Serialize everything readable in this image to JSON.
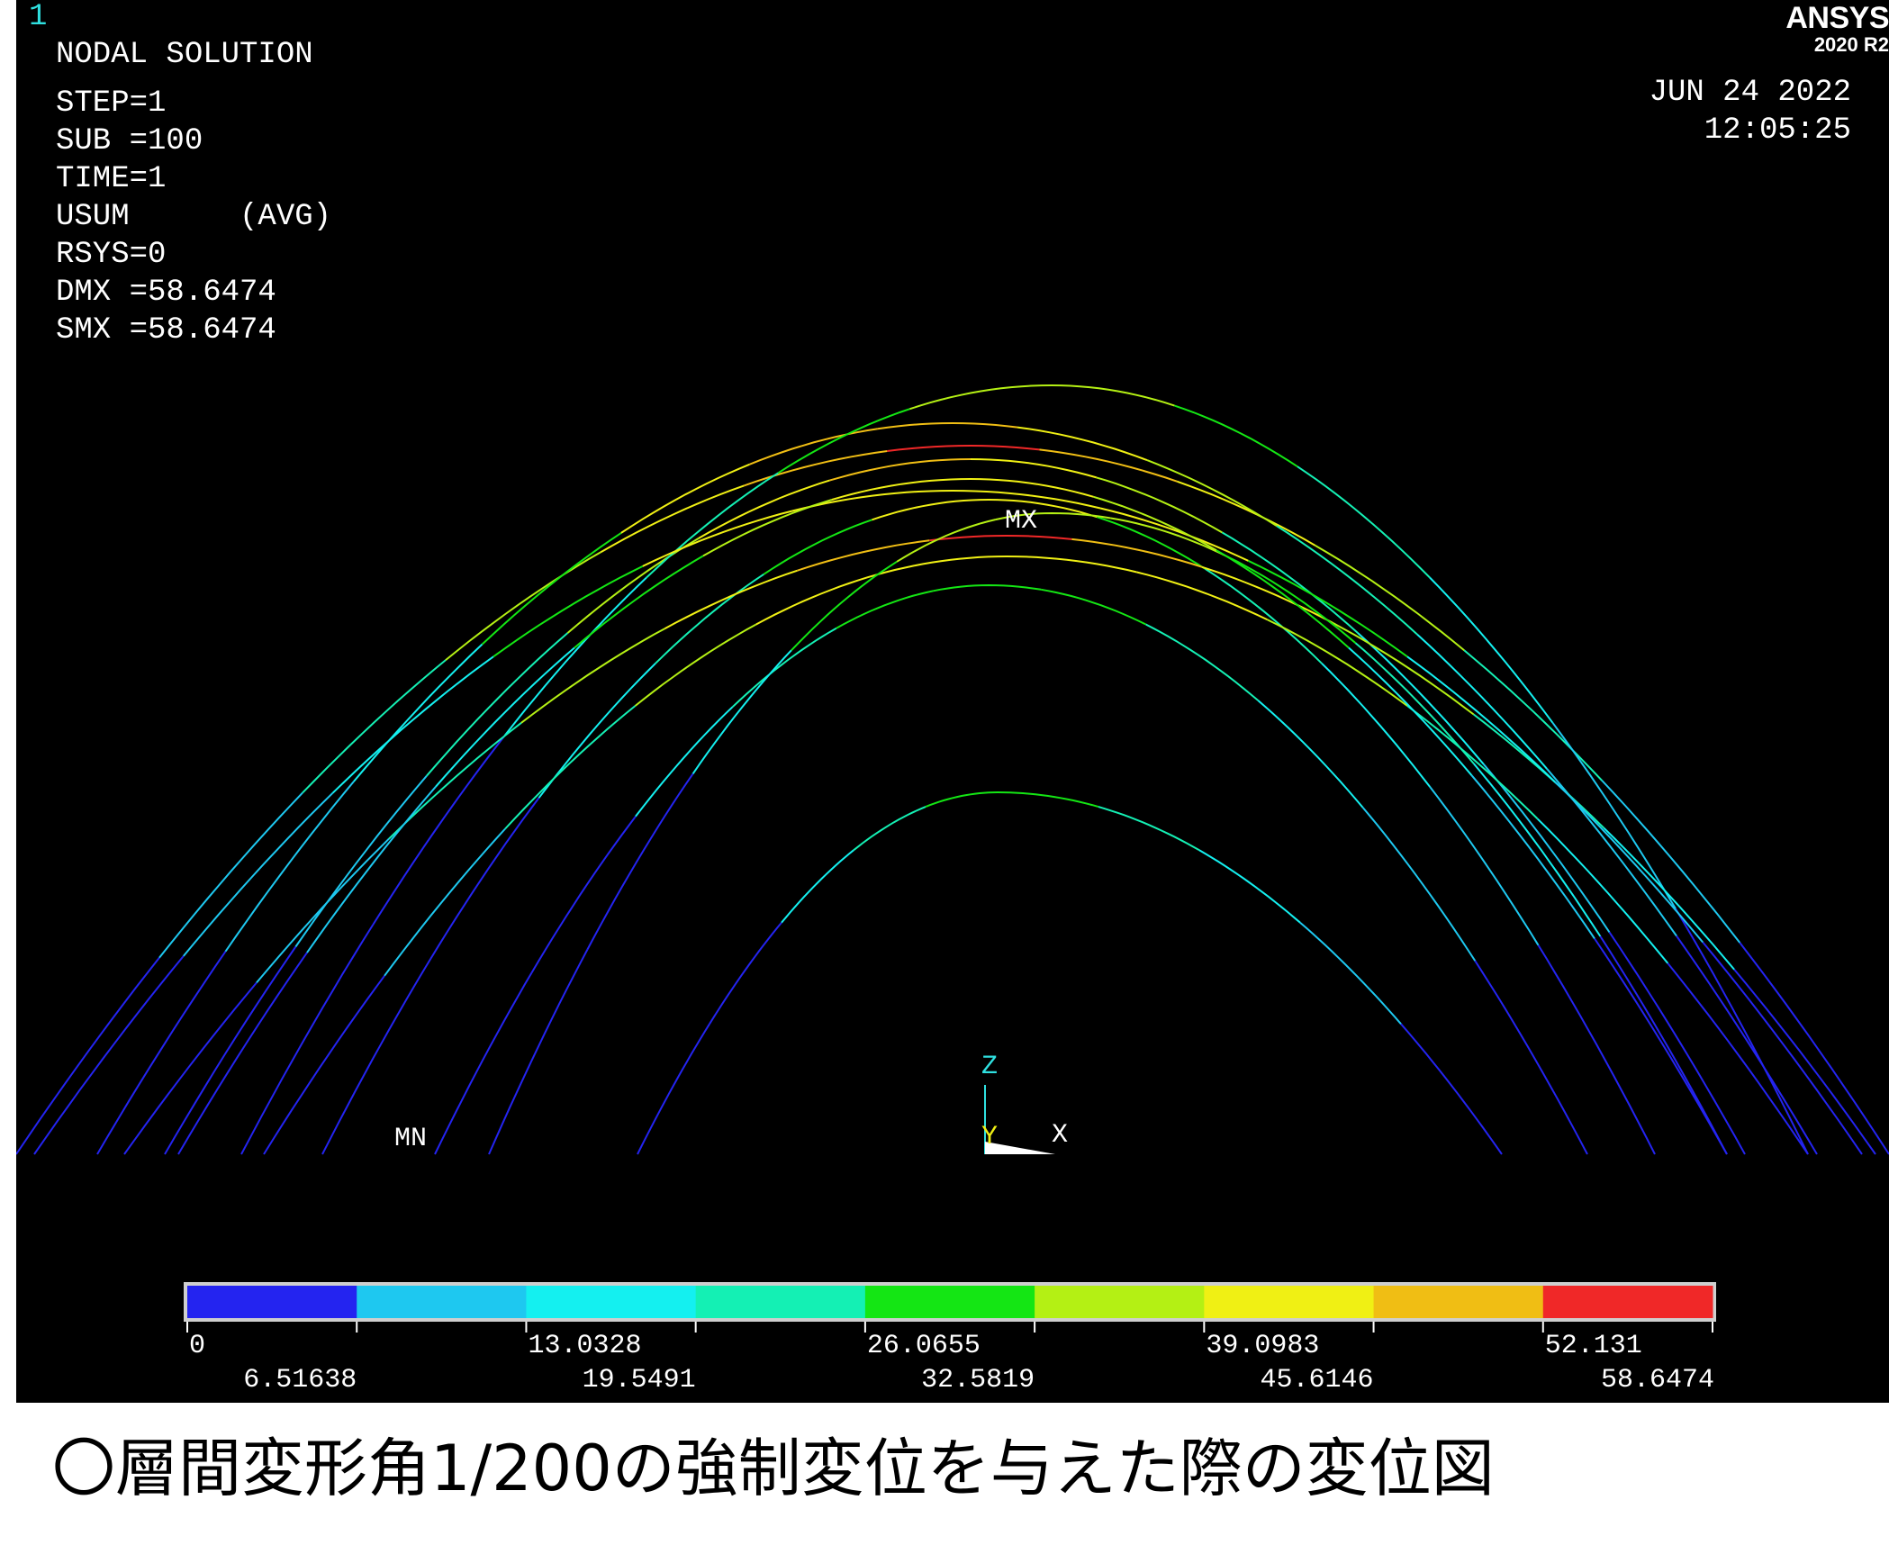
{
  "window_number": "1",
  "header": {
    "title": "NODAL SOLUTION",
    "lines": [
      "STEP=1",
      "SUB =100",
      "TIME=1",
      "USUM      (AVG)",
      "RSYS=0",
      "DMX =58.6474",
      "SMX =58.6474"
    ]
  },
  "brand": {
    "name": "ANSYS",
    "version": "2020 R2"
  },
  "date": "JUN 24 2022",
  "time": "12:05:25",
  "markers": {
    "max": "MX",
    "min": "MN"
  },
  "triad": {
    "z": "Z",
    "y": "Y",
    "x": "X"
  },
  "legend": {
    "colors": [
      "#2424f0",
      "#1ec8f0",
      "#14f0f0",
      "#14f0b4",
      "#14e614",
      "#b4f014",
      "#f0f014",
      "#f0be14",
      "#f02828"
    ],
    "top_labels": [
      "0",
      "13.0328",
      "26.0655",
      "39.0983",
      "52.131"
    ],
    "bottom_labels": [
      "6.51638",
      "19.5491",
      "32.5819",
      "45.6146",
      "58.6474"
    ]
  },
  "caption": "〇層間変形角1/200の強制変位を与えた際の変位図"
}
